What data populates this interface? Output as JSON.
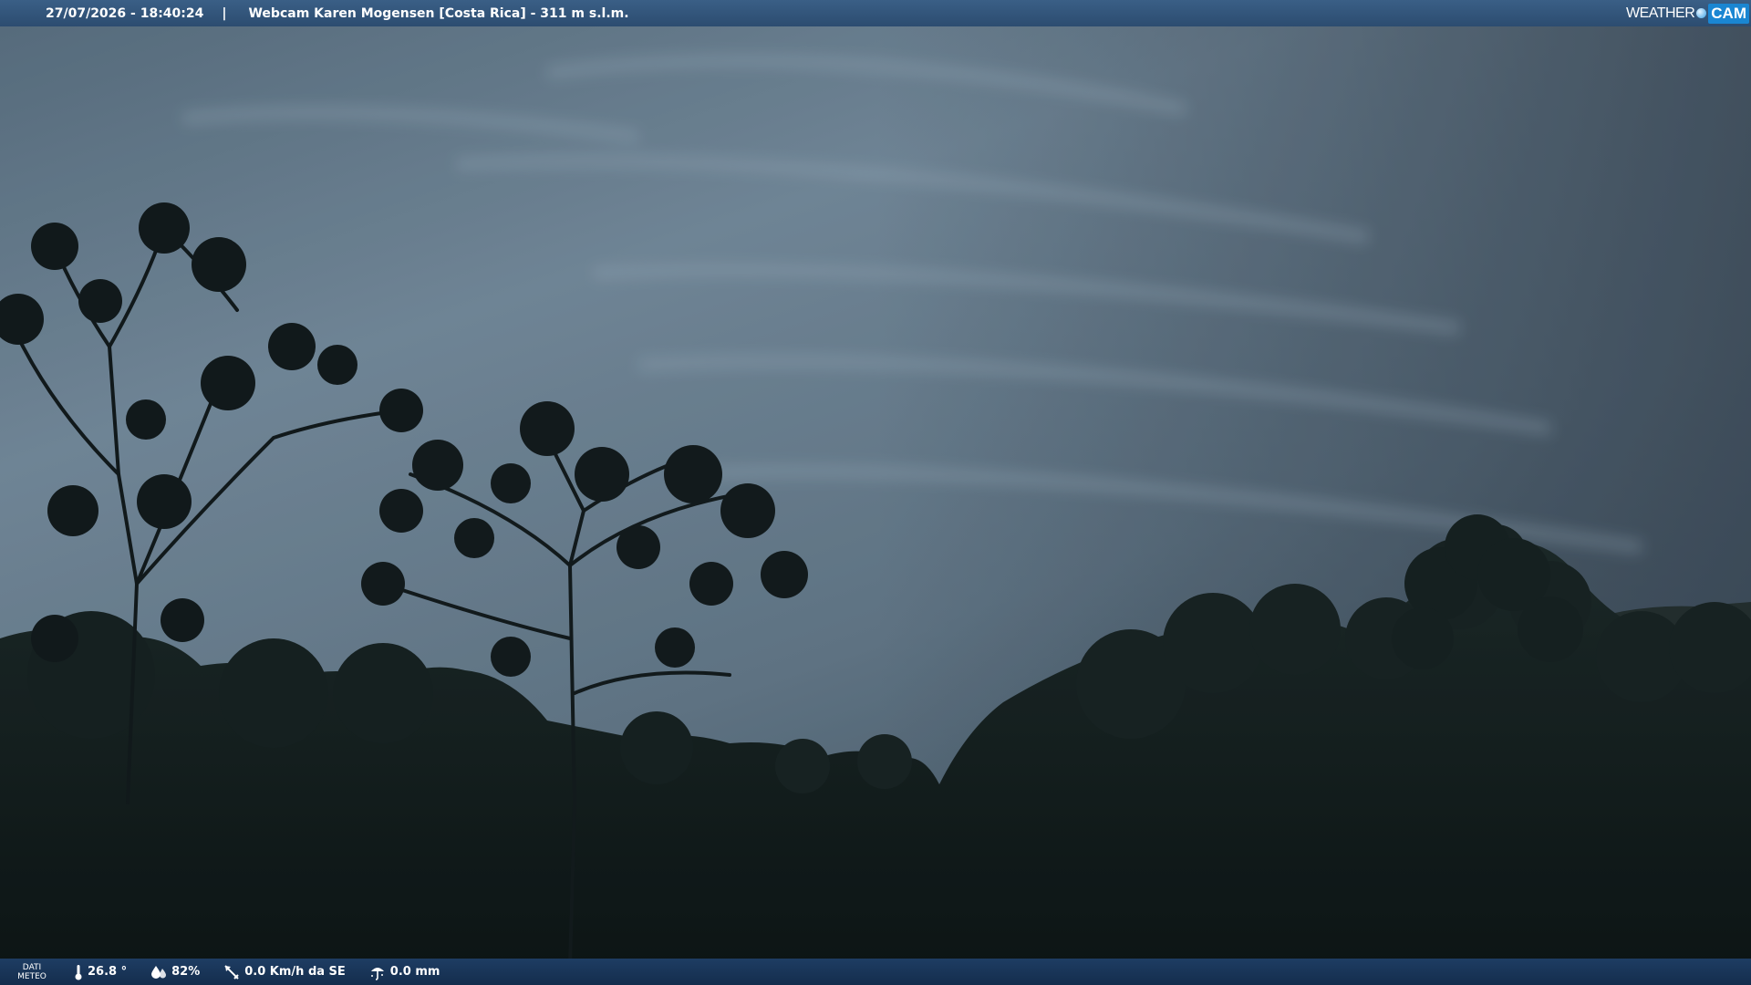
{
  "top_bar": {
    "datetime": "27/07/2026 - 18:40:24",
    "separator": "|",
    "title": "Webcam Karen Mogensen [Costa Rica]  - 311 m s.l.m."
  },
  "logo": {
    "word1": "WEATHER",
    "word2": "CAM"
  },
  "bottom_bar": {
    "label_line1": "DATI",
    "label_line2": "METEO",
    "temperature": "26.8 °",
    "humidity": "82%",
    "wind": "0.0 Km/h da SE",
    "rain": "0.0 mm"
  },
  "colors": {
    "top_bar": "#2f5278",
    "bottom_bar": "#1a3658",
    "sky": "#6f8596",
    "vegetation": "#141c1b"
  },
  "icons": [
    "thermometer-icon",
    "humidity-drop-icon",
    "wind-vane-icon",
    "rain-gauge-icon"
  ]
}
